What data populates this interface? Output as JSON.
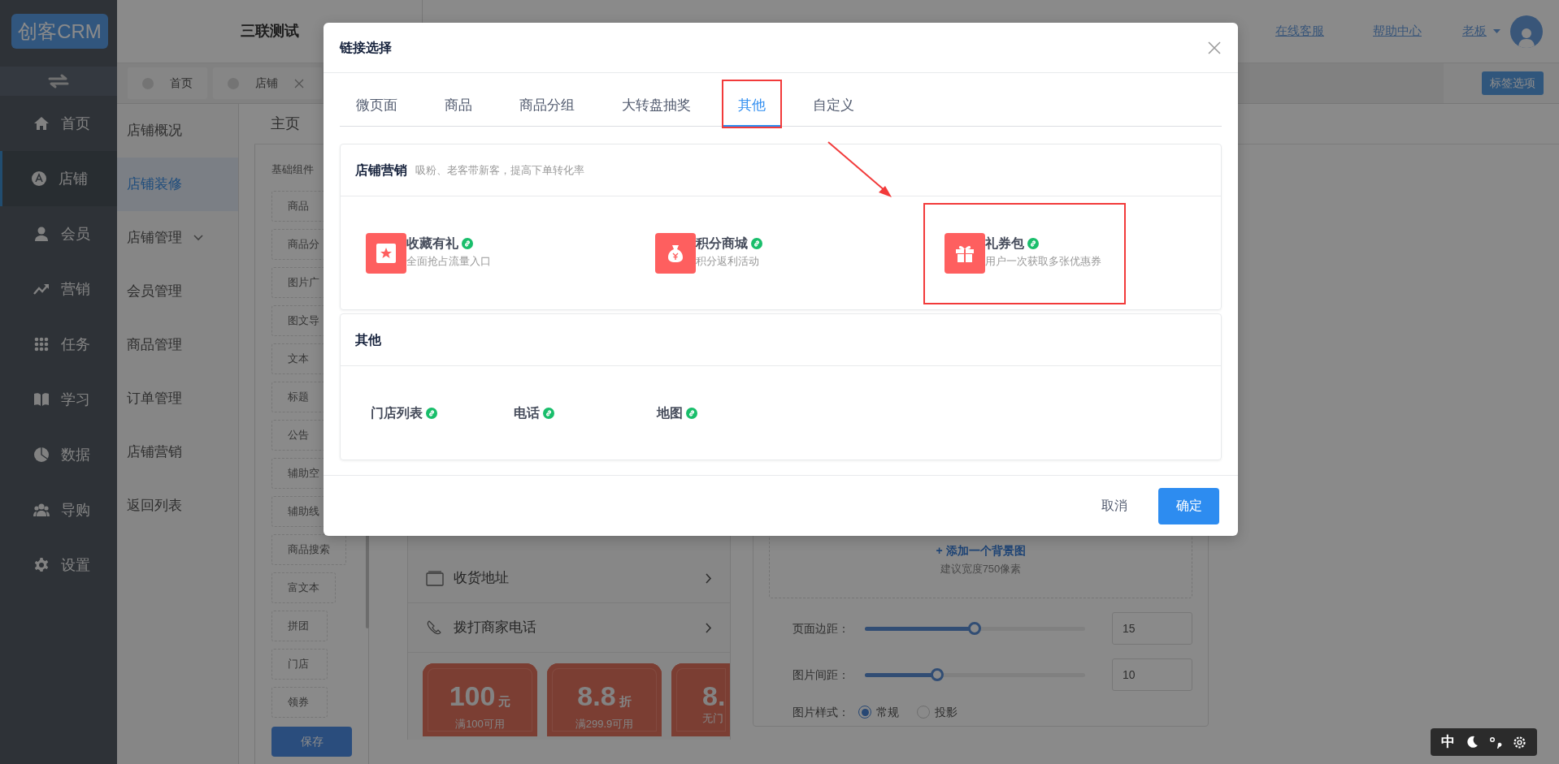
{
  "sidebar": {
    "logo": "创客CRM",
    "items": [
      {
        "label": "首页",
        "selected": false
      },
      {
        "label": "店铺",
        "selected": true
      },
      {
        "label": "会员",
        "selected": false
      },
      {
        "label": "营销",
        "selected": false
      },
      {
        "label": "任务",
        "selected": false
      },
      {
        "label": "学习",
        "selected": false
      },
      {
        "label": "数据",
        "selected": false
      },
      {
        "label": "导购",
        "selected": false
      },
      {
        "label": "设置",
        "selected": false
      }
    ]
  },
  "header": {
    "store_name": "三联测试",
    "links": [
      "在线客服",
      "帮助中心"
    ],
    "user": "老板"
  },
  "page_tabs": {
    "tabs": [
      {
        "label": "首页",
        "closable": false
      },
      {
        "label": "店铺",
        "closable": true
      }
    ],
    "options_button": "标签选项"
  },
  "subnav": {
    "items": [
      {
        "label": "店铺概况",
        "selected": false,
        "expandable": false
      },
      {
        "label": "店铺装修",
        "selected": true,
        "expandable": false
      },
      {
        "label": "店铺管理",
        "selected": false,
        "expandable": true
      },
      {
        "label": "会员管理",
        "selected": false,
        "expandable": false
      },
      {
        "label": "商品管理",
        "selected": false,
        "expandable": false
      },
      {
        "label": "订单管理",
        "selected": false,
        "expandable": false
      },
      {
        "label": "店铺营销",
        "selected": false,
        "expandable": false
      },
      {
        "label": "返回列表",
        "selected": false,
        "expandable": false
      }
    ]
  },
  "page_title": "主页",
  "components": {
    "title": "基础组件",
    "items": [
      "商品",
      "商品分",
      "图片广",
      "图文导",
      "文本",
      "标题",
      "公告",
      "辅助空",
      "辅助线",
      "商品搜索",
      "富文本",
      "拼团",
      "门店",
      "领券"
    ],
    "save_button": "保存"
  },
  "preview": {
    "rows": [
      "收货地址",
      "拨打商家电话"
    ],
    "coupons": [
      {
        "amount": "100",
        "unit": "元",
        "condition": "满100可用"
      },
      {
        "amount": "8.8",
        "unit": "折",
        "condition": "满299.9可用"
      },
      {
        "amount": "8.",
        "condition": "无门"
      }
    ]
  },
  "settings": {
    "background_link": "+ 添加一个背景图",
    "background_hint": "建议宽度750像素",
    "sliders": [
      {
        "label": "页面边距：",
        "level": 0.5,
        "value": "15"
      },
      {
        "label": "图片间距：",
        "level": 0.33,
        "value": "10"
      }
    ],
    "image_style": {
      "label": "图片样式：",
      "options": [
        {
          "label": "常规",
          "selected": true
        },
        {
          "label": "投影",
          "selected": false
        }
      ]
    }
  },
  "modal": {
    "title": "链接选择",
    "tabs": [
      {
        "label": "微页面",
        "selected": false,
        "highlighted": false
      },
      {
        "label": "商品",
        "selected": false,
        "highlighted": false
      },
      {
        "label": "商品分组",
        "selected": false,
        "highlighted": false
      },
      {
        "label": "大转盘抽奖",
        "selected": false,
        "highlighted": false
      },
      {
        "label": "其他",
        "selected": true,
        "highlighted": true
      },
      {
        "label": "自定义",
        "selected": false,
        "highlighted": false
      }
    ],
    "sections": [
      {
        "title": "店铺营销",
        "subtitle": "吸粉、老客带新客，提高下单转化率",
        "items": [
          {
            "kind": "tile",
            "title": "收藏有礼",
            "subtitle": "全面抢占流量入口",
            "highlighted": false
          },
          {
            "kind": "tile",
            "title": "积分商城",
            "subtitle": "积分返利活动",
            "highlighted": false
          },
          {
            "kind": "tile",
            "title": "礼券包",
            "subtitle": "用户一次获取多张优惠券",
            "highlighted": true
          }
        ]
      },
      {
        "title": "其他",
        "items": [
          {
            "kind": "link",
            "title": "门店列表",
            "highlighted": false
          },
          {
            "kind": "link",
            "title": "电话",
            "highlighted": false
          },
          {
            "kind": "link",
            "title": "地图",
            "highlighted": false
          }
        ]
      }
    ],
    "pointer_arrow": true,
    "buttons": [
      {
        "label": "取消",
        "kind": "secondary"
      },
      {
        "label": "确定",
        "kind": "primary"
      }
    ]
  },
  "ime_toolbar": {
    "mode": "中"
  }
}
